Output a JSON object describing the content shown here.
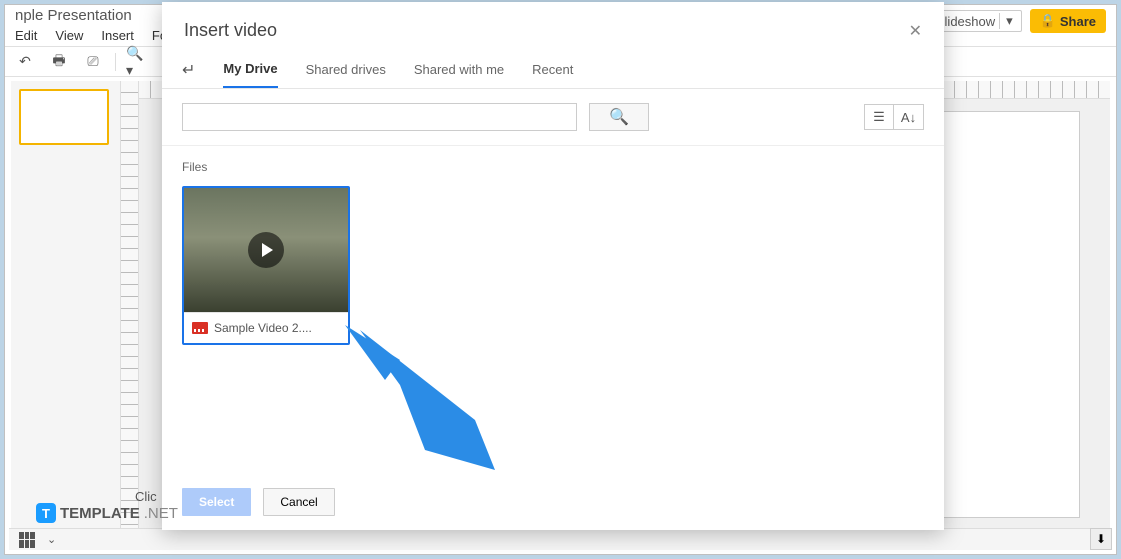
{
  "window": {
    "title_fragment": "nple Presentation"
  },
  "menu": {
    "edit": "Edit",
    "view": "View",
    "insert": "Insert",
    "fo": "Fo"
  },
  "topright": {
    "slideshow": "Slideshow",
    "share": "Share"
  },
  "canvas": {
    "click": "Clic"
  },
  "modal": {
    "title": "Insert video",
    "tabs": {
      "my_drive": "My Drive",
      "shared_drives": "Shared drives",
      "shared_with_me": "Shared with me",
      "recent": "Recent"
    },
    "files_label": "Files",
    "file": {
      "name": "Sample Video 2...."
    },
    "buttons": {
      "select": "Select",
      "cancel": "Cancel"
    }
  },
  "watermark": {
    "t": "T",
    "brand": "TEMPLATE",
    "net": ".NET"
  }
}
